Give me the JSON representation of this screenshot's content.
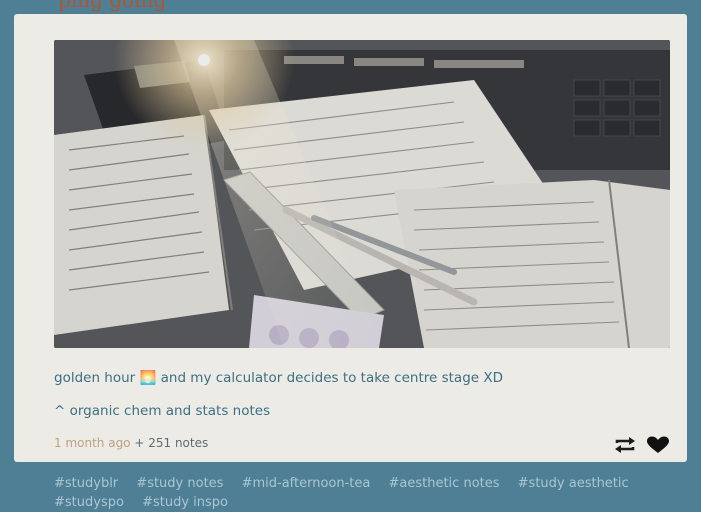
{
  "header": {
    "partial_title": "ping going"
  },
  "post": {
    "image_alt": "study desk with notes, calculator, keyboard and pens in golden hour light",
    "caption_main": "golden hour 🌅 and my calculator decides to take centre stage XD",
    "caption_sub": "^ organic chem and stats notes",
    "time_ago": "1 month ago",
    "notes": "+ 251 notes",
    "reblog_icon": "reblog-icon",
    "like_icon": "heart-icon"
  },
  "tags": [
    "#studyblr",
    "#study notes",
    "#mid-afternoon-tea",
    "#aesthetic notes",
    "#study aesthetic",
    "#studyspo",
    "#study inspo"
  ],
  "colors": {
    "page_bg": "#4f7f95",
    "card_bg": "#ecebe6",
    "caption": "#3d6f84",
    "time": "#c0a07e",
    "tags": "#a9c6d3"
  }
}
